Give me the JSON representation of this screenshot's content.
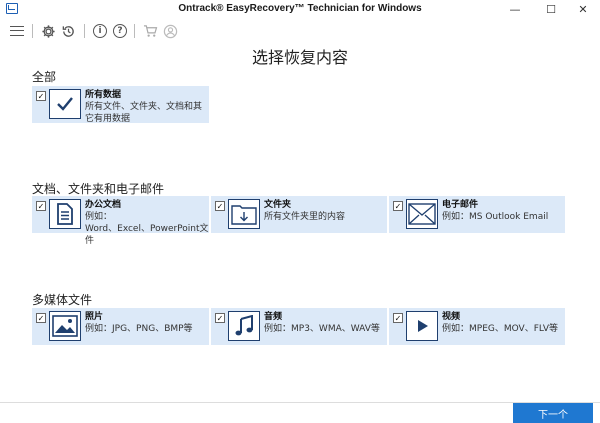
{
  "window": {
    "title": "Ontrack® EasyRecovery™ Technician for Windows",
    "minimize_glyph": "—",
    "maximize_glyph": "☐",
    "close_glyph": "✕"
  },
  "toolbar": {
    "info_glyph": "i",
    "help_glyph": "?"
  },
  "page": {
    "title": "选择恢复内容"
  },
  "sections": {
    "all": {
      "title": "全部",
      "cards": [
        {
          "heading": "所有数据",
          "line1": "所有文件、文件夹、文档和其",
          "line2": "它有用数据",
          "checked": "✓"
        }
      ]
    },
    "docs": {
      "title": "文档、文件夹和电子邮件",
      "cards": [
        {
          "heading": "办公文档",
          "line1": "例如：",
          "line2": "Word、Excel、PowerPoint文件",
          "checked": "✓"
        },
        {
          "heading": "文件夹",
          "line1": "所有文件夹里的内容",
          "line2": "",
          "checked": "✓"
        },
        {
          "heading": "电子邮件",
          "line1": "例如：MS Outlook Email",
          "line2": "",
          "checked": "✓"
        }
      ]
    },
    "media": {
      "title": "多媒体文件",
      "cards": [
        {
          "heading": "照片",
          "line1": "例如：JPG、PNG、BMP等",
          "line2": "",
          "checked": "✓"
        },
        {
          "heading": "音频",
          "line1": "例如：MP3、WMA、WAV等",
          "line2": "",
          "checked": "✓"
        },
        {
          "heading": "视频",
          "line1": "例如：MPEG、MOV、FLV等",
          "line2": "",
          "checked": "✓"
        }
      ]
    }
  },
  "footer": {
    "next_label": "下一个"
  },
  "colors": {
    "card_bg": "#dce9f8",
    "icon_border": "#1f3f6e",
    "next_button": "#1f78d1"
  }
}
